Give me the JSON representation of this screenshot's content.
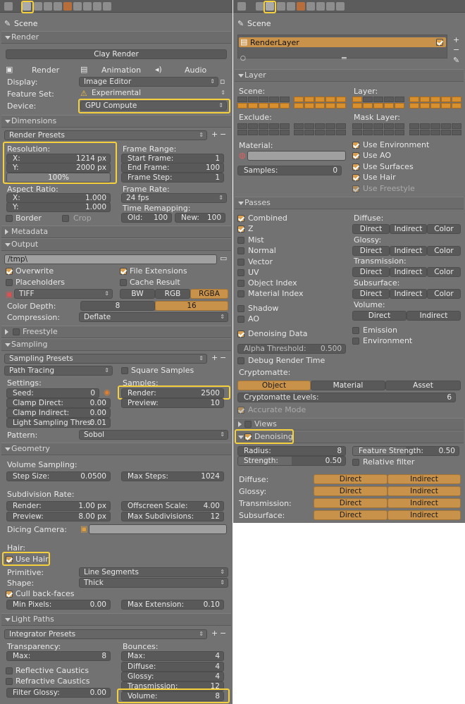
{
  "left": {
    "context": "Scene",
    "render": {
      "title": "Render",
      "clay": "Clay Render",
      "render_btn": "Render",
      "animation_btn": "Animation",
      "audio_btn": "Audio",
      "display_label": "Display:",
      "display_value": "Image Editor",
      "feature_label": "Feature Set:",
      "feature_value": "Experimental",
      "device_label": "Device:",
      "device_value": "GPU Compute"
    },
    "dimensions": {
      "title": "Dimensions",
      "presets": "Render Presets",
      "resolution": "Resolution:",
      "x_label": "X:",
      "x_value": "1214 px",
      "y_label": "Y:",
      "y_value": "2000 px",
      "percent": "100%",
      "frame_range": "Frame Range:",
      "start_label": "Start Frame:",
      "start_value": "1",
      "end_label": "End Frame:",
      "end_value": "100",
      "step_label": "Frame Step:",
      "step_value": "1",
      "aspect": "Aspect Ratio:",
      "ax_label": "X:",
      "ax_value": "1.000",
      "ay_label": "Y:",
      "ay_value": "1.000",
      "frame_rate": "Frame Rate:",
      "fps": "24 fps",
      "remap": "Time Remapping:",
      "old_label": "Old:",
      "old_value": "100",
      "new_label": "New:",
      "new_value": "100",
      "border": "Border",
      "crop": "Crop"
    },
    "metadata": "Metadata",
    "output": {
      "title": "Output",
      "path": "/tmp\\",
      "overwrite": "Overwrite",
      "file_ext": "File Extensions",
      "placeholders": "Placeholders",
      "cache": "Cache Result",
      "format": "TIFF",
      "bw": "BW",
      "rgb": "RGB",
      "rgba": "RGBA",
      "depth_label": "Color Depth:",
      "depth_8": "8",
      "depth_16": "16",
      "compression_label": "Compression:",
      "compression_value": "Deflate"
    },
    "freestyle": "Freestyle",
    "sampling": {
      "title": "Sampling",
      "presets": "Sampling Presets",
      "integrator": "Path Tracing",
      "square": "Square Samples",
      "settings": "Settings:",
      "samples": "Samples:",
      "seed_label": "Seed:",
      "seed_value": "0",
      "clamp_direct_label": "Clamp Direct:",
      "clamp_direct_value": "0.00",
      "clamp_indirect_label": "Clamp Indirect:",
      "clamp_indirect_value": "0.00",
      "light_label": "Light Sampling Thres:",
      "light_value": "0.01",
      "render_label": "Render:",
      "render_value": "2500",
      "preview_label": "Preview:",
      "preview_value": "10",
      "pattern_label": "Pattern:",
      "pattern_value": "Sobol"
    },
    "geometry": {
      "title": "Geometry",
      "volume_sampling": "Volume Sampling:",
      "step_label": "Step Size:",
      "step_value": "0.0500",
      "max_steps_label": "Max Steps:",
      "max_steps_value": "1024",
      "subdiv_rate": "Subdivision Rate:",
      "render_label": "Render:",
      "render_value": "1.00 px",
      "offscreen_label": "Offscreen Scale:",
      "offscreen_value": "4.00",
      "preview_label": "Preview:",
      "preview_value": "8.00 px",
      "max_subdiv_label": "Max Subdivisions:",
      "max_subdiv_value": "12",
      "dicing_label": "Dicing Camera:",
      "hair": "Hair:",
      "use_hair": "Use Hair",
      "primitive_label": "Primitive:",
      "primitive_value": "Line Segments",
      "shape_label": "Shape:",
      "shape_value": "Thick",
      "cull": "Cull back-faces",
      "min_px_label": "Min Pixels:",
      "min_px_value": "0.00",
      "max_ext_label": "Max Extension:",
      "max_ext_value": "0.10"
    },
    "light_paths": {
      "title": "Light Paths",
      "presets": "Integrator Presets",
      "transparency": "Transparency:",
      "bounces": "Bounces:",
      "tmax_label": "Max:",
      "tmax_value": "8",
      "bmax_label": "Max:",
      "bmax_value": "4",
      "diffuse_label": "Diffuse:",
      "diffuse_value": "4",
      "glossy_label": "Glossy:",
      "glossy_value": "4",
      "transmission_label": "Transmission:",
      "transmission_value": "12",
      "volume_label": "Volume:",
      "volume_value": "8",
      "reflective": "Reflective Caustics",
      "refractive": "Refractive Caustics",
      "filter_label": "Filter Glossy:",
      "filter_value": "0.00"
    }
  },
  "right": {
    "context": "Scene",
    "render_layer": "RenderLayer",
    "layer": {
      "title": "Layer",
      "scene": "Scene:",
      "layer": "Layer:",
      "exclude": "Exclude:",
      "mask": "Mask Layer:",
      "material": "Material:",
      "samples_label": "Samples:",
      "samples_value": "0",
      "use_env": "Use Environment",
      "use_ao": "Use AO",
      "use_surfaces": "Use Surfaces",
      "use_hair": "Use Hair",
      "use_freestyle": "Use Freestyle"
    },
    "passes": {
      "title": "Passes",
      "combined": "Combined",
      "z": "Z",
      "mist": "Mist",
      "normal": "Normal",
      "vector": "Vector",
      "uv": "UV",
      "object_index": "Object Index",
      "material_index": "Material Index",
      "shadow": "Shadow",
      "ao": "AO",
      "denoising_data": "Denoising Data",
      "alpha_label": "Alpha Threshold:",
      "alpha_value": "0.500",
      "debug": "Debug Render Time",
      "diffuse": "Diffuse:",
      "glossy": "Glossy:",
      "transmission": "Transmission:",
      "subsurface": "Subsurface:",
      "volume": "Volume:",
      "direct": "Direct",
      "indirect": "Indirect",
      "color": "Color",
      "emission": "Emission",
      "environment": "Environment",
      "cryptomatte": "Cryptomatte:",
      "crypto_object": "Object",
      "crypto_material": "Material",
      "crypto_asset": "Asset",
      "crypto_levels_label": "Cryptomatte Levels:",
      "crypto_levels_value": "6",
      "accurate": "Accurate Mode"
    },
    "views": "Views",
    "denoising": {
      "title": "Denoising",
      "radius_label": "Radius:",
      "radius_value": "8",
      "strength_label": "Strength:",
      "strength_value": "0.50",
      "feature_label": "Feature Strength:",
      "feature_value": "0.50",
      "relative": "Relative filter",
      "diffuse": "Diffuse:",
      "glossy": "Glossy:",
      "transmission": "Transmission:",
      "subsurface": "Subsurface:",
      "direct": "Direct",
      "indirect": "Indirect"
    }
  },
  "colors": {
    "panel": "#727272",
    "highlight": "#f4d03f",
    "accent": "#c9924a"
  }
}
